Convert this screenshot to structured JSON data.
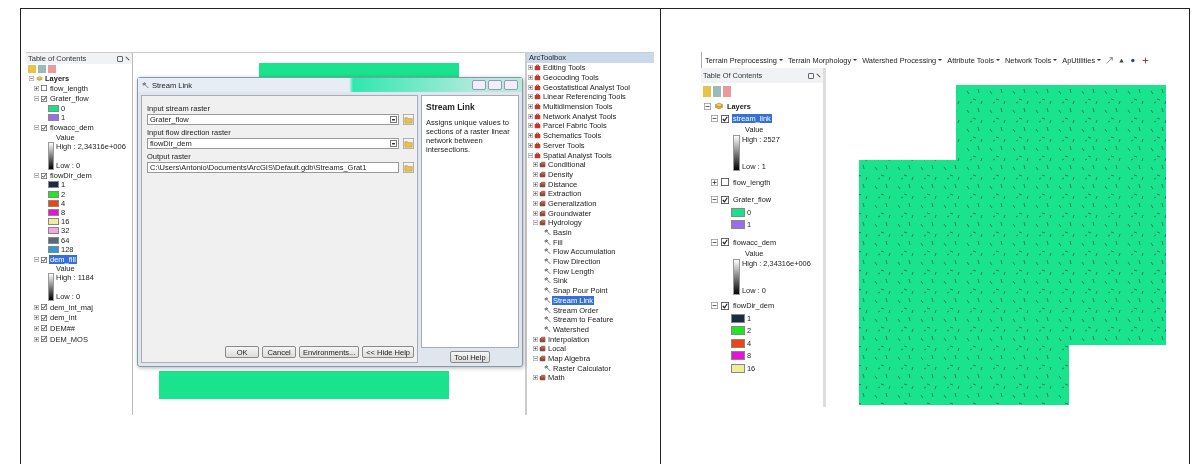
{
  "left_screenshot": {
    "toc": {
      "title": "Table of Contents",
      "root": {
        "label": "Layers",
        "expanded": true
      },
      "layers": [
        {
          "name": "flow_length",
          "checked": false,
          "expanded": false,
          "selected": false
        },
        {
          "name": "Grater_flow",
          "checked": true,
          "expanded": true,
          "selected": false,
          "legend": {
            "kind": "classes",
            "classes": [
              {
                "label": "0",
                "color": "#19e08a"
              },
              {
                "label": "1",
                "color": "#9a6ee8"
              }
            ]
          }
        },
        {
          "name": "flowacc_dem",
          "checked": true,
          "expanded": true,
          "selected": false,
          "legend": {
            "kind": "ramp",
            "heading": "Value",
            "high": "High : 2,34316e+006",
            "low": "Low : 0"
          }
        },
        {
          "name": "flowDir_dem",
          "checked": true,
          "expanded": true,
          "selected": false,
          "legend": {
            "kind": "classes",
            "classes": [
              {
                "label": "1",
                "color": "#1c2b44"
              },
              {
                "label": "2",
                "color": "#22e622"
              },
              {
                "label": "4",
                "color": "#ee4411"
              },
              {
                "label": "8",
                "color": "#e614d8"
              },
              {
                "label": "16",
                "color": "#eeee99"
              },
              {
                "label": "32",
                "color": "#f2a6e2"
              },
              {
                "label": "64",
                "color": "#5a6a78"
              },
              {
                "label": "128",
                "color": "#3399cc"
              }
            ]
          }
        },
        {
          "name": "dem_fill",
          "checked": true,
          "expanded": true,
          "selected": true,
          "legend": {
            "kind": "ramp",
            "heading": "Value",
            "high": "High : 1184",
            "low": "Low : 0"
          }
        },
        {
          "name": "dem_int_maj",
          "checked": true,
          "expanded": false,
          "selected": false
        },
        {
          "name": "dem_int",
          "checked": true,
          "expanded": false,
          "selected": false
        },
        {
          "name": "DEM##",
          "checked": true,
          "expanded": false,
          "selected": false
        },
        {
          "name": "DEM_MOS",
          "checked": true,
          "expanded": false,
          "selected": false
        }
      ]
    },
    "dialog": {
      "title": "Stream Link",
      "parameters": [
        {
          "label": "Input stream raster",
          "value": "Grater_flow",
          "kind": "dropdown"
        },
        {
          "label": "Input flow direction raster",
          "value": "flowDir_dem",
          "kind": "dropdown"
        },
        {
          "label": "Output raster",
          "value": "C:\\Users\\Antonio\\Documents\\ArcGIS\\Default.gdb\\Streams_Grat1",
          "kind": "text"
        }
      ],
      "buttons": [
        "OK",
        "Cancel",
        "Environments...",
        "<< Hide Help"
      ],
      "help": {
        "title": "Stream Link",
        "text": "Assigns unique values to sections of a raster linear network between intersections.",
        "button": "Tool Help"
      }
    },
    "toolbox": {
      "title": "ArcToolbox",
      "items": [
        {
          "label": "Editing Tools",
          "kind": "toolbox",
          "expanded": false,
          "selected": false
        },
        {
          "label": "Geocoding Tools",
          "kind": "toolbox",
          "expanded": false,
          "selected": false
        },
        {
          "label": "Geostatistical Analyst Tool",
          "kind": "toolbox",
          "expanded": false,
          "selected": false
        },
        {
          "label": "Linear Referencing Tools",
          "kind": "toolbox",
          "expanded": false,
          "selected": false
        },
        {
          "label": "Multidimension Tools",
          "kind": "toolbox",
          "expanded": false,
          "selected": false
        },
        {
          "label": "Network Analyst Tools",
          "kind": "toolbox",
          "expanded": false,
          "selected": false
        },
        {
          "label": "Parcel Fabric Tools",
          "kind": "toolbox",
          "expanded": false,
          "selected": false
        },
        {
          "label": "Schematics Tools",
          "kind": "toolbox",
          "expanded": false,
          "selected": false
        },
        {
          "label": "Server Tools",
          "kind": "toolbox",
          "expanded": false,
          "selected": false
        },
        {
          "label": "Spatial Analyst Tools",
          "kind": "toolbox",
          "expanded": true,
          "selected": false,
          "children": [
            {
              "label": "Conditional",
              "kind": "toolset",
              "expanded": false,
              "selected": false
            },
            {
              "label": "Density",
              "kind": "toolset",
              "expanded": false,
              "selected": false
            },
            {
              "label": "Distance",
              "kind": "toolset",
              "expanded": false,
              "selected": false
            },
            {
              "label": "Extraction",
              "kind": "toolset",
              "expanded": false,
              "selected": false
            },
            {
              "label": "Generalization",
              "kind": "toolset",
              "expanded": false,
              "selected": false
            },
            {
              "label": "Groundwater",
              "kind": "toolset",
              "expanded": false,
              "selected": false
            },
            {
              "label": "Hydrology",
              "kind": "toolset",
              "expanded": true,
              "selected": false,
              "children": [
                {
                  "label": "Basin",
                  "kind": "tool",
                  "selected": false
                },
                {
                  "label": "Fill",
                  "kind": "tool",
                  "selected": false
                },
                {
                  "label": "Flow Accumulation",
                  "kind": "tool",
                  "selected": false
                },
                {
                  "label": "Flow Direction",
                  "kind": "tool",
                  "selected": false
                },
                {
                  "label": "Flow Length",
                  "kind": "tool",
                  "selected": false
                },
                {
                  "label": "Sink",
                  "kind": "tool",
                  "selected": false
                },
                {
                  "label": "Snap Pour Point",
                  "kind": "tool",
                  "selected": false
                },
                {
                  "label": "Stream Link",
                  "kind": "tool",
                  "selected": true
                },
                {
                  "label": "Stream Order",
                  "kind": "tool",
                  "selected": false
                },
                {
                  "label": "Stream to Feature",
                  "kind": "tool",
                  "selected": false
                },
                {
                  "label": "Watershed",
                  "kind": "tool",
                  "selected": false
                }
              ]
            },
            {
              "label": "Interpolation",
              "kind": "toolset",
              "expanded": false,
              "selected": false
            },
            {
              "label": "Local",
              "kind": "toolset",
              "expanded": false,
              "selected": false
            },
            {
              "label": "Map Algebra",
              "kind": "toolset",
              "expanded": true,
              "selected": false,
              "children": [
                {
                  "label": "Raster Calculator",
                  "kind": "tool",
                  "selected": false
                }
              ]
            },
            {
              "label": "Math",
              "kind": "toolset",
              "expanded": false,
              "selected": false
            }
          ]
        }
      ]
    }
  },
  "right_screenshot": {
    "toolbar": [
      "Terrain Preprocessing",
      "Terrain Morphology",
      "Watershed Processing",
      "Attribute Tools",
      "Network Tools",
      "ApUtilities"
    ],
    "toc": {
      "title": "Table Of Contents",
      "root": {
        "label": "Layers",
        "expanded": true
      },
      "layers": [
        {
          "name": "stream_link",
          "checked": true,
          "expanded": true,
          "selected": true,
          "legend": {
            "kind": "ramp",
            "heading": "Value",
            "high": "High : 2527",
            "low": "Low : 1"
          }
        },
        {
          "name": "flow_length",
          "checked": false,
          "expanded": false,
          "selected": false
        },
        {
          "name": "Grater_flow",
          "checked": true,
          "expanded": true,
          "selected": false,
          "legend": {
            "kind": "classes",
            "classes": [
              {
                "label": "0",
                "color": "#19e08a"
              },
              {
                "label": "1",
                "color": "#9a6ee8"
              }
            ]
          }
        },
        {
          "name": "flowacc_dem",
          "checked": true,
          "expanded": true,
          "selected": false,
          "legend": {
            "kind": "ramp",
            "heading": "Value",
            "high": "High : 2,34316e+006",
            "low": "Low : 0"
          }
        },
        {
          "name": "flowDir_dem",
          "checked": true,
          "expanded": true,
          "selected": false,
          "legend": {
            "kind": "classes",
            "classes": [
              {
                "label": "1",
                "color": "#1c2b44"
              },
              {
                "label": "2",
                "color": "#22e622"
              },
              {
                "label": "4",
                "color": "#ee4411"
              },
              {
                "label": "8",
                "color": "#e614d8"
              },
              {
                "label": "16",
                "color": "#eeee99"
              }
            ]
          }
        }
      ]
    }
  }
}
